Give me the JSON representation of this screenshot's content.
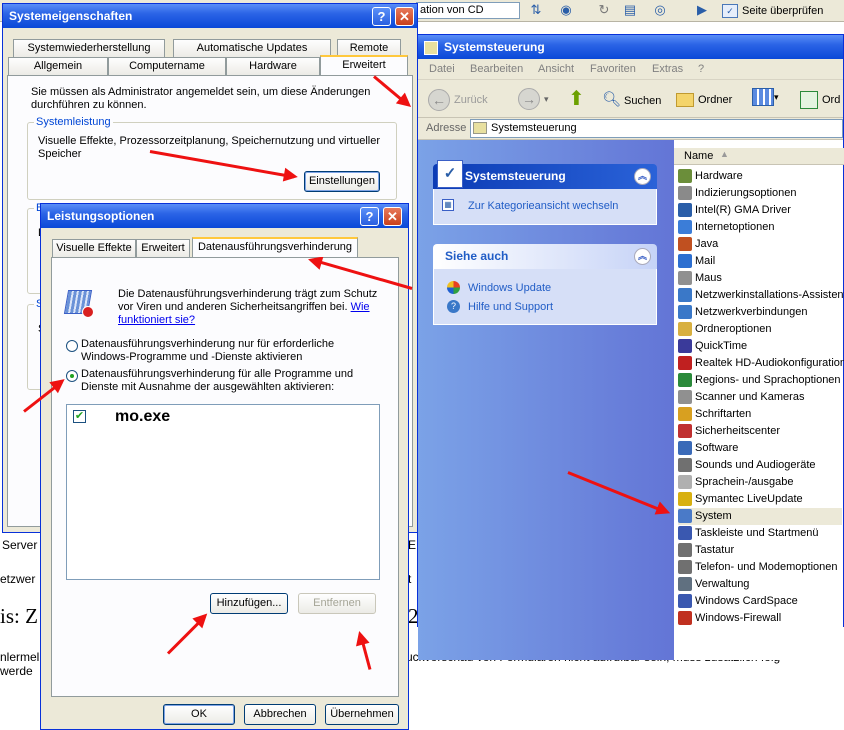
{
  "browser": {
    "address_partial": "ation von CD",
    "check_page_label": "Seite überprüfen",
    "text_server": "Server",
    "text_netzwer": "etzwer",
    "text_is": "is: Z",
    "text_2": "2",
    "text_nlermel": "nlermel",
    "text_werde": "werde",
    "text_E": "E",
    "text_t": "t",
    "text_print_preview": "uckvorschau von Formularen nicht aufrufbar sein, muss zusätzlich folg"
  },
  "system_properties": {
    "title": "Systemeigenschaften",
    "tabs_row1": [
      "Systemwiederherstellung",
      "Automatische Updates",
      "Remote"
    ],
    "tabs_row2": [
      "Allgemein",
      "Computername",
      "Hardware",
      "Erweitert"
    ],
    "admin_note": "Sie müssen als Administrator angemeldet sein, um diese Änderungen durchführen zu können.",
    "group_title": "Systemleistung",
    "group_text": "Visuelle Effekte, Prozessorzeitplanung, Speichernutzung und virtueller Speicher",
    "settings_button": "Einstellungen",
    "hidden_labels": [
      "B",
      "D",
      "S",
      "S"
    ]
  },
  "performance_options": {
    "title": "Leistungsoptionen",
    "tabs": [
      "Visuelle Effekte",
      "Erweitert",
      "Datenausführungsverhinderung"
    ],
    "description": "Die Datenausführungsverhinderung trägt zum Schutz vor Viren und anderen Sicherheitsangriffen bei.",
    "link": "Wie funktioniert sie?",
    "radio1": "Datenausführungsverhinderung nur für erforderliche Windows-Programme und -Dienste aktivieren",
    "radio2": "Datenausführungsverhinderung für alle Programme und Dienste mit Ausnahme der ausgewählten aktivieren:",
    "list_item": "mo.exe",
    "add_button": "Hinzufügen...",
    "remove_button": "Entfernen",
    "ok_button": "OK",
    "cancel_button": "Abbrechen",
    "apply_button": "Übernehmen"
  },
  "control_panel": {
    "title": "Systemsteuerung",
    "menu": [
      "Datei",
      "Bearbeiten",
      "Ansicht",
      "Favoriten",
      "Extras",
      "?"
    ],
    "toolbar": {
      "back": "Zurück",
      "search": "Suchen",
      "folders": "Ordner",
      "extra": "Ord"
    },
    "address_label": "Adresse",
    "address_value": "Systemsteuerung",
    "panel1_title": "Systemsteuerung",
    "panel1_link": "Zur Kategorieansicht wechseln",
    "panel2_title": "Siehe auch",
    "panel2_links": [
      "Windows Update",
      "Hilfe und Support"
    ],
    "column_name": "Name",
    "items": [
      "Hardware",
      "Indizierungsoptionen",
      "Intel(R) GMA Driver",
      "Internetoptionen",
      "Java",
      "Mail",
      "Maus",
      "Netzwerkinstallations-Assistent",
      "Netzwerkverbindungen",
      "Ordneroptionen",
      "QuickTime",
      "Realtek HD-Audiokonfiguration",
      "Regions- und Sprachoptionen",
      "Scanner und Kameras",
      "Schriftarten",
      "Sicherheitscenter",
      "Software",
      "Sounds und Audiogeräte",
      "Sprachein-/ausgabe",
      "Symantec LiveUpdate",
      "System",
      "Taskleiste und Startmenü",
      "Tastatur",
      "Telefon- und Modemoptionen",
      "Verwaltung",
      "Windows CardSpace",
      "Windows-Firewall"
    ],
    "selected_item": "System",
    "icon_colors": [
      "#6b8e3a",
      "#8a8a8a",
      "#2a5ea8",
      "#3b7dd8",
      "#c05020",
      "#2d6fd0",
      "#909090",
      "#3a78c8",
      "#3a78c8",
      "#d8b040",
      "#3a3a9a",
      "#c02020",
      "#2a8a3a",
      "#909090",
      "#d8a020",
      "#c03030",
      "#3a6ab8",
      "#707070",
      "#b0b0b0",
      "#d8b010",
      "#4a7ac8",
      "#3a58b0",
      "#707070",
      "#707070",
      "#607080",
      "#3a58b0",
      "#c03020"
    ]
  }
}
